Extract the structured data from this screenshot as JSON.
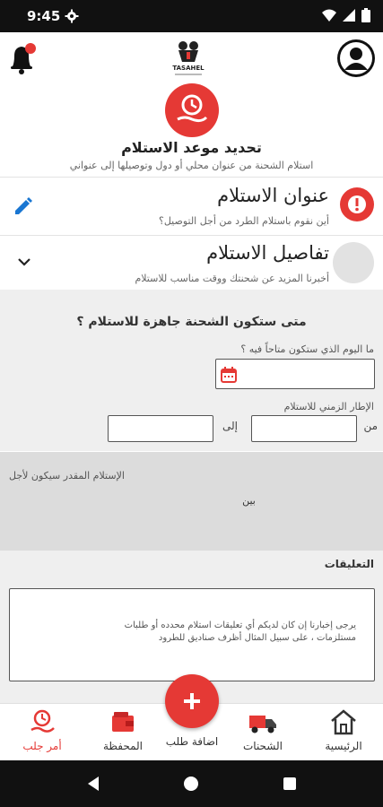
{
  "status_bar": {
    "time": "9:45"
  },
  "header": {
    "brand": "TASAHEL"
  },
  "hero": {
    "title": "تحديد موعد الاستلام",
    "subtitle": "استلام الشحنة من عنوان محلي أو دول وتوصيلها إلى عنواني"
  },
  "address_card": {
    "title": "عنوان الاستلام",
    "subtitle": "أين نقوم باستلام الطرد من أجل التوصيل؟"
  },
  "details_card": {
    "title": "تفاصيل الاستلام",
    "subtitle": "أخبرنا المزيد عن شحنتك ووقت مناسب للاستلام"
  },
  "form": {
    "question": "متى ستكون الشحنة جاهزة للاستلام ؟",
    "day_label": "ما اليوم الذي ستكون متاحاً فيه ؟",
    "timeframe_label": "الإطار الزمني للاستلام",
    "from_label": "من",
    "to_label": "إلى",
    "from_value": "",
    "to_value": "",
    "date_value": ""
  },
  "estimate": {
    "label": "الإستلام المقدر سيكون لأجل",
    "value": "بين"
  },
  "comments": {
    "label": "التعليقات",
    "placeholder": "يرجى إخبارنا إن كان لديكم أي تعليقات استلام محدده أو طلبات مستلزمات ، على سبيل المثال أظرف صناديق للطرود"
  },
  "bottom_nav": {
    "home": "الرئيسية",
    "shipments": "الشحنات",
    "add_order": "اضافة طلب",
    "wallet": "المحفظة",
    "my_orders": "أمر جلب"
  },
  "colors": {
    "accent": "#e53935",
    "grey_bg": "#efefef",
    "edit_blue": "#1976d2"
  }
}
